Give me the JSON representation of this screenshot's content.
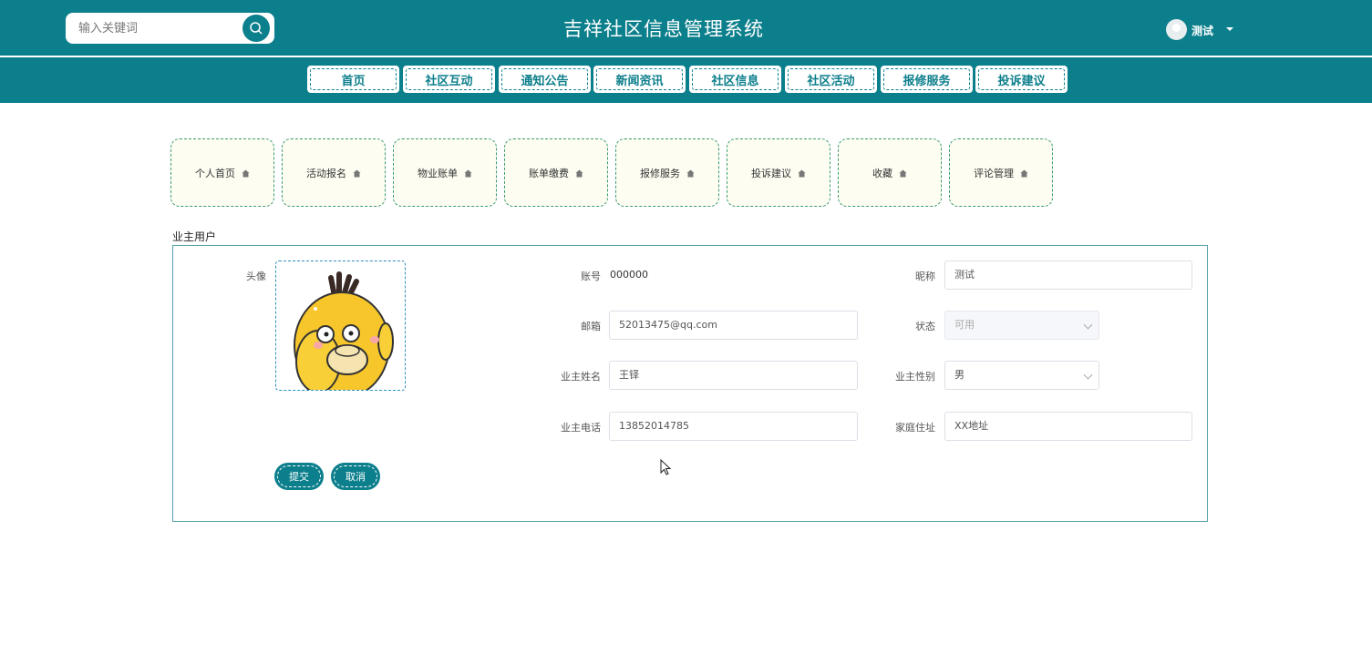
{
  "header": {
    "search_placeholder": "输入关键词",
    "title": "吉祥社区信息管理系统",
    "username": "测试"
  },
  "nav": [
    "首页",
    "社区互动",
    "通知公告",
    "新闻资讯",
    "社区信息",
    "社区活动",
    "报修服务",
    "投诉建议"
  ],
  "tiles": [
    "个人首页",
    "活动报名",
    "物业账单",
    "账单缴费",
    "报修服务",
    "投诉建议",
    "收藏",
    "评论管理"
  ],
  "form": {
    "section_title": "业主用户",
    "avatar_label": "头像",
    "account_label": "账号",
    "account_value": "000000",
    "nickname_label": "昵称",
    "nickname_value": "测试",
    "email_label": "邮箱",
    "email_value": "52013475@qq.com",
    "status_label": "状态",
    "status_value": "可用",
    "name_label": "业主姓名",
    "name_value": "王铎",
    "gender_label": "业主性别",
    "gender_value": "男",
    "phone_label": "业主电话",
    "phone_value": "13852014785",
    "address_label": "家庭住址",
    "address_value": "XX地址",
    "submit_label": "提交",
    "cancel_label": "取消"
  },
  "colors": {
    "primary": "#0c7f8c",
    "tile_border": "#3a9a72",
    "tile_bg": "#fdfdf2"
  }
}
